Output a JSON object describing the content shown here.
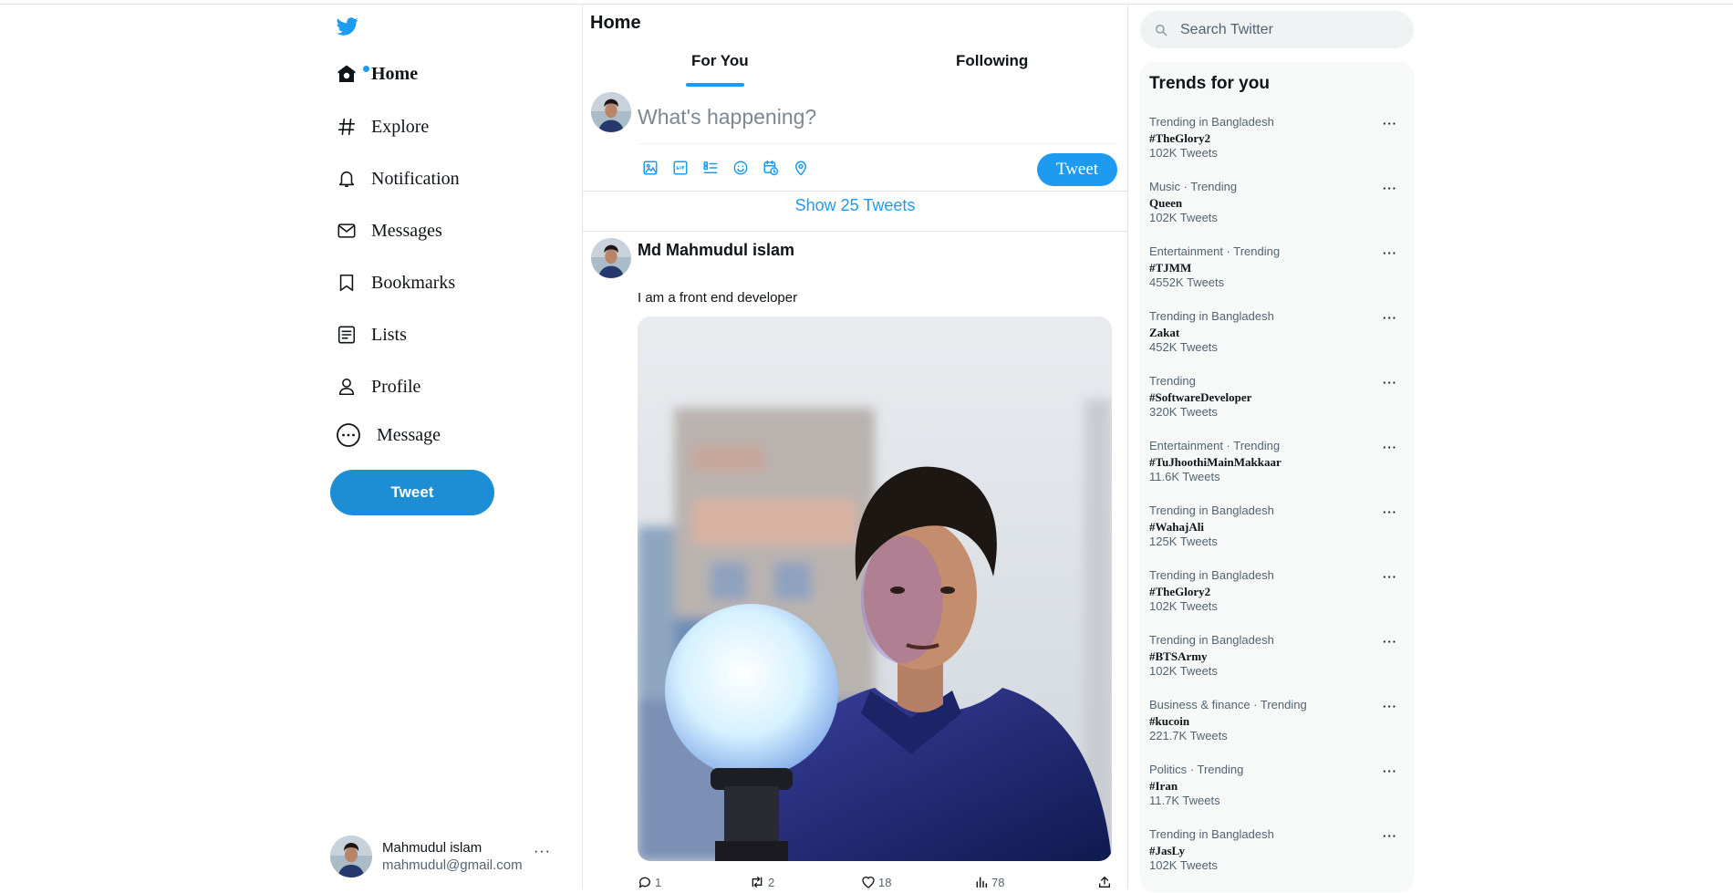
{
  "colors": {
    "accent": "#1d9bf0",
    "tweet_button": "#1d8ed6",
    "text": "#0f1419",
    "muted": "#536471"
  },
  "sidebar": {
    "logo_icon": "twitter-bird-icon",
    "nav": [
      {
        "label": "Home",
        "icon": "home-icon",
        "active": true
      },
      {
        "label": "Explore",
        "icon": "hashtag-icon"
      },
      {
        "label": "Notification",
        "icon": "bell-icon"
      },
      {
        "label": "Messages",
        "icon": "envelope-icon"
      },
      {
        "label": "Bookmarks",
        "icon": "bookmark-icon"
      },
      {
        "label": "Lists",
        "icon": "list-icon"
      },
      {
        "label": "Profile",
        "icon": "person-icon"
      },
      {
        "label": "Message",
        "icon": "more-circle-icon"
      }
    ],
    "tweet_button": "Tweet",
    "account": {
      "name": "Mahmudul islam",
      "email": "mahmudul@gmail.com",
      "more": "···"
    }
  },
  "main": {
    "title": "Home",
    "tabs": [
      {
        "label": "For You",
        "active": true
      },
      {
        "label": "Following"
      }
    ],
    "composer": {
      "placeholder": "What's happening?",
      "tools": [
        "image-icon",
        "gif-icon",
        "poll-icon",
        "emoji-icon",
        "schedule-icon",
        "location-icon"
      ],
      "tweet_button": "Tweet"
    },
    "show_tweets": "Show 25 Tweets",
    "post": {
      "author": "Md Mahmudul islam",
      "text": "I am a front end developer",
      "actions": {
        "replies": "1",
        "retweets": "2",
        "likes": "18",
        "views": "78"
      }
    }
  },
  "right": {
    "search_placeholder": "Search Twitter",
    "trends_title": "Trends for you",
    "trends": [
      {
        "context": "Trending in Bangladesh",
        "name": "#TheGlory2",
        "count": "102K Tweets"
      },
      {
        "context": "Music · Trending",
        "name": "Queen",
        "count": "102K Tweets"
      },
      {
        "context": "Entertainment · Trending",
        "name": "#TJMM",
        "count": "4552K Tweets"
      },
      {
        "context": "Trending in Bangladesh",
        "name": "Zakat",
        "count": "452K Tweets"
      },
      {
        "context": "Trending",
        "name": "#SoftwareDeveloper",
        "count": "320K Tweets"
      },
      {
        "context": "Entertainment · Trending",
        "name": "#TuJhoothiMainMakkaar",
        "count": "11.6K Tweets"
      },
      {
        "context": "Trending in Bangladesh",
        "name": "#WahajAli",
        "count": "125K Tweets"
      },
      {
        "context": "Trending in Bangladesh",
        "name": "#TheGlory2",
        "count": "102K Tweets"
      },
      {
        "context": "Trending in Bangladesh",
        "name": "#BTSArmy",
        "count": "102K Tweets"
      },
      {
        "context": "Business & finance · Trending",
        "name": "#kucoin",
        "count": "221.7K Tweets"
      },
      {
        "context": "Politics · Trending",
        "name": "#Iran",
        "count": "11.7K Tweets"
      },
      {
        "context": "Trending in Bangladesh",
        "name": "#JasLy",
        "count": "102K Tweets"
      }
    ]
  }
}
